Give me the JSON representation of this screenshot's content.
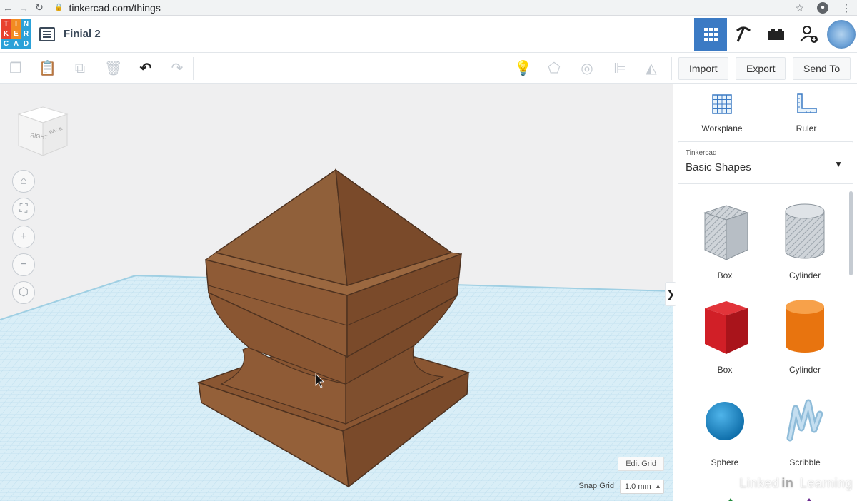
{
  "browser": {
    "url": "tinkercad.com/things",
    "back_icon": "back-arrow-icon",
    "forward_icon": "forward-arrow-icon",
    "reload_icon": "reload-icon",
    "star_icon": "star-icon",
    "profile_icon": "profile-icon",
    "menu_icon": "kebab-menu-icon"
  },
  "logo": {
    "letters": [
      "T",
      "I",
      "N",
      "K",
      "E",
      "R",
      "C",
      "A",
      "D"
    ],
    "colors": [
      "#e8422f",
      "#f28b22",
      "#2ba1d8",
      "#e8422f",
      "#f28b22",
      "#2ba1d8",
      "#2ba1d8",
      "#2ba1d8",
      "#2ba1d8"
    ]
  },
  "header": {
    "title": "Finial 2",
    "accent": "#3b7ac4"
  },
  "toolbar": {
    "icons": [
      "copy-icon",
      "paste-icon",
      "duplicate-icon",
      "delete-icon",
      "undo-icon",
      "redo-icon",
      "light-bulb-icon",
      "shape-group-icon",
      "ungroup-icon",
      "align-icon",
      "mirror-icon"
    ],
    "import_label": "Import",
    "export_label": "Export",
    "sendto_label": "Send To"
  },
  "viewcube": {
    "right": "RIGHT",
    "back": "BACK"
  },
  "workspace": {
    "edit_grid": "Edit Grid",
    "snap_label": "Snap Grid",
    "snap_value": "1.0 mm",
    "grid_color": "#b8dcec",
    "object_color": "#8f5b36"
  },
  "panel": {
    "workplane_label": "Workplane",
    "ruler_label": "Ruler",
    "library_small": "Tinkercad",
    "library_big": "Basic Shapes",
    "shapes": [
      {
        "label": "Box",
        "kind": "box-hole"
      },
      {
        "label": "Cylinder",
        "kind": "cylinder-hole"
      },
      {
        "label": "Box",
        "kind": "box"
      },
      {
        "label": "Cylinder",
        "kind": "cylinder"
      },
      {
        "label": "Sphere",
        "kind": "sphere"
      },
      {
        "label": "Scribble",
        "kind": "scribble"
      }
    ]
  },
  "watermark": {
    "pre": "Linked",
    "in": "in",
    "post": "Learning"
  }
}
